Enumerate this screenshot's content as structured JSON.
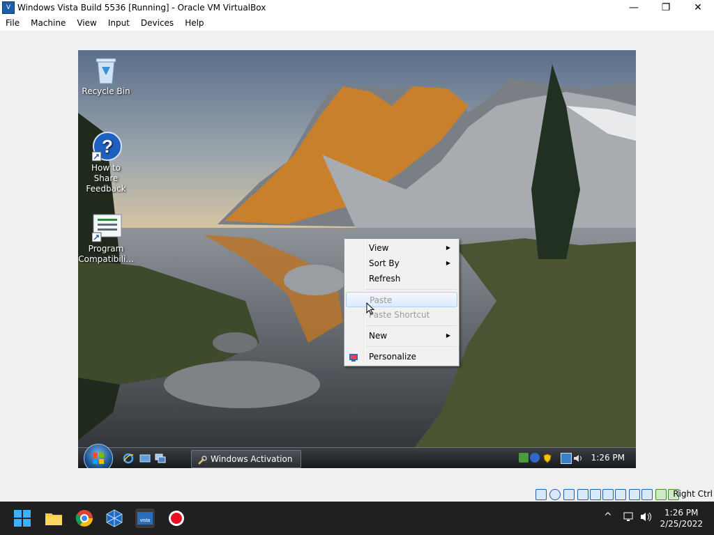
{
  "window": {
    "title": "Windows Vista Build 5536 [Running] - Oracle VM VirtualBox",
    "controls": {
      "minimize": "—",
      "restore": "❐",
      "close": "✕"
    }
  },
  "menubar": {
    "items": [
      {
        "label": "File"
      },
      {
        "label": "Machine"
      },
      {
        "label": "View"
      },
      {
        "label": "Input"
      },
      {
        "label": "Devices"
      },
      {
        "label": "Help"
      }
    ]
  },
  "desktop": {
    "icons": [
      {
        "line1": "Recycle Bin",
        "line2": ""
      },
      {
        "line1": "How to Share",
        "line2": "Feedback"
      },
      {
        "line1": "Program",
        "line2": "Compatibili..."
      }
    ]
  },
  "context_menu": {
    "items": [
      {
        "label": "View",
        "submenu": true,
        "disabled": false
      },
      {
        "label": "Sort By",
        "submenu": true,
        "disabled": false
      },
      {
        "label": "Refresh",
        "submenu": false,
        "disabled": false
      },
      {
        "label": "Paste",
        "submenu": false,
        "disabled": true
      },
      {
        "label": "Paste Shortcut",
        "submenu": false,
        "disabled": true
      },
      {
        "label": "New",
        "submenu": true,
        "disabled": false
      },
      {
        "label": "Personalize",
        "submenu": false,
        "disabled": false
      }
    ],
    "arrow": "▶"
  },
  "guest_taskbar": {
    "task_button_label": "Windows Activation",
    "clock": "1:26 PM"
  },
  "statusbar": {
    "right_ctrl": "Right Ctrl"
  },
  "host_taskbar": {
    "time": "1:26 PM",
    "date": "2/25/2022",
    "chevron": "^"
  }
}
